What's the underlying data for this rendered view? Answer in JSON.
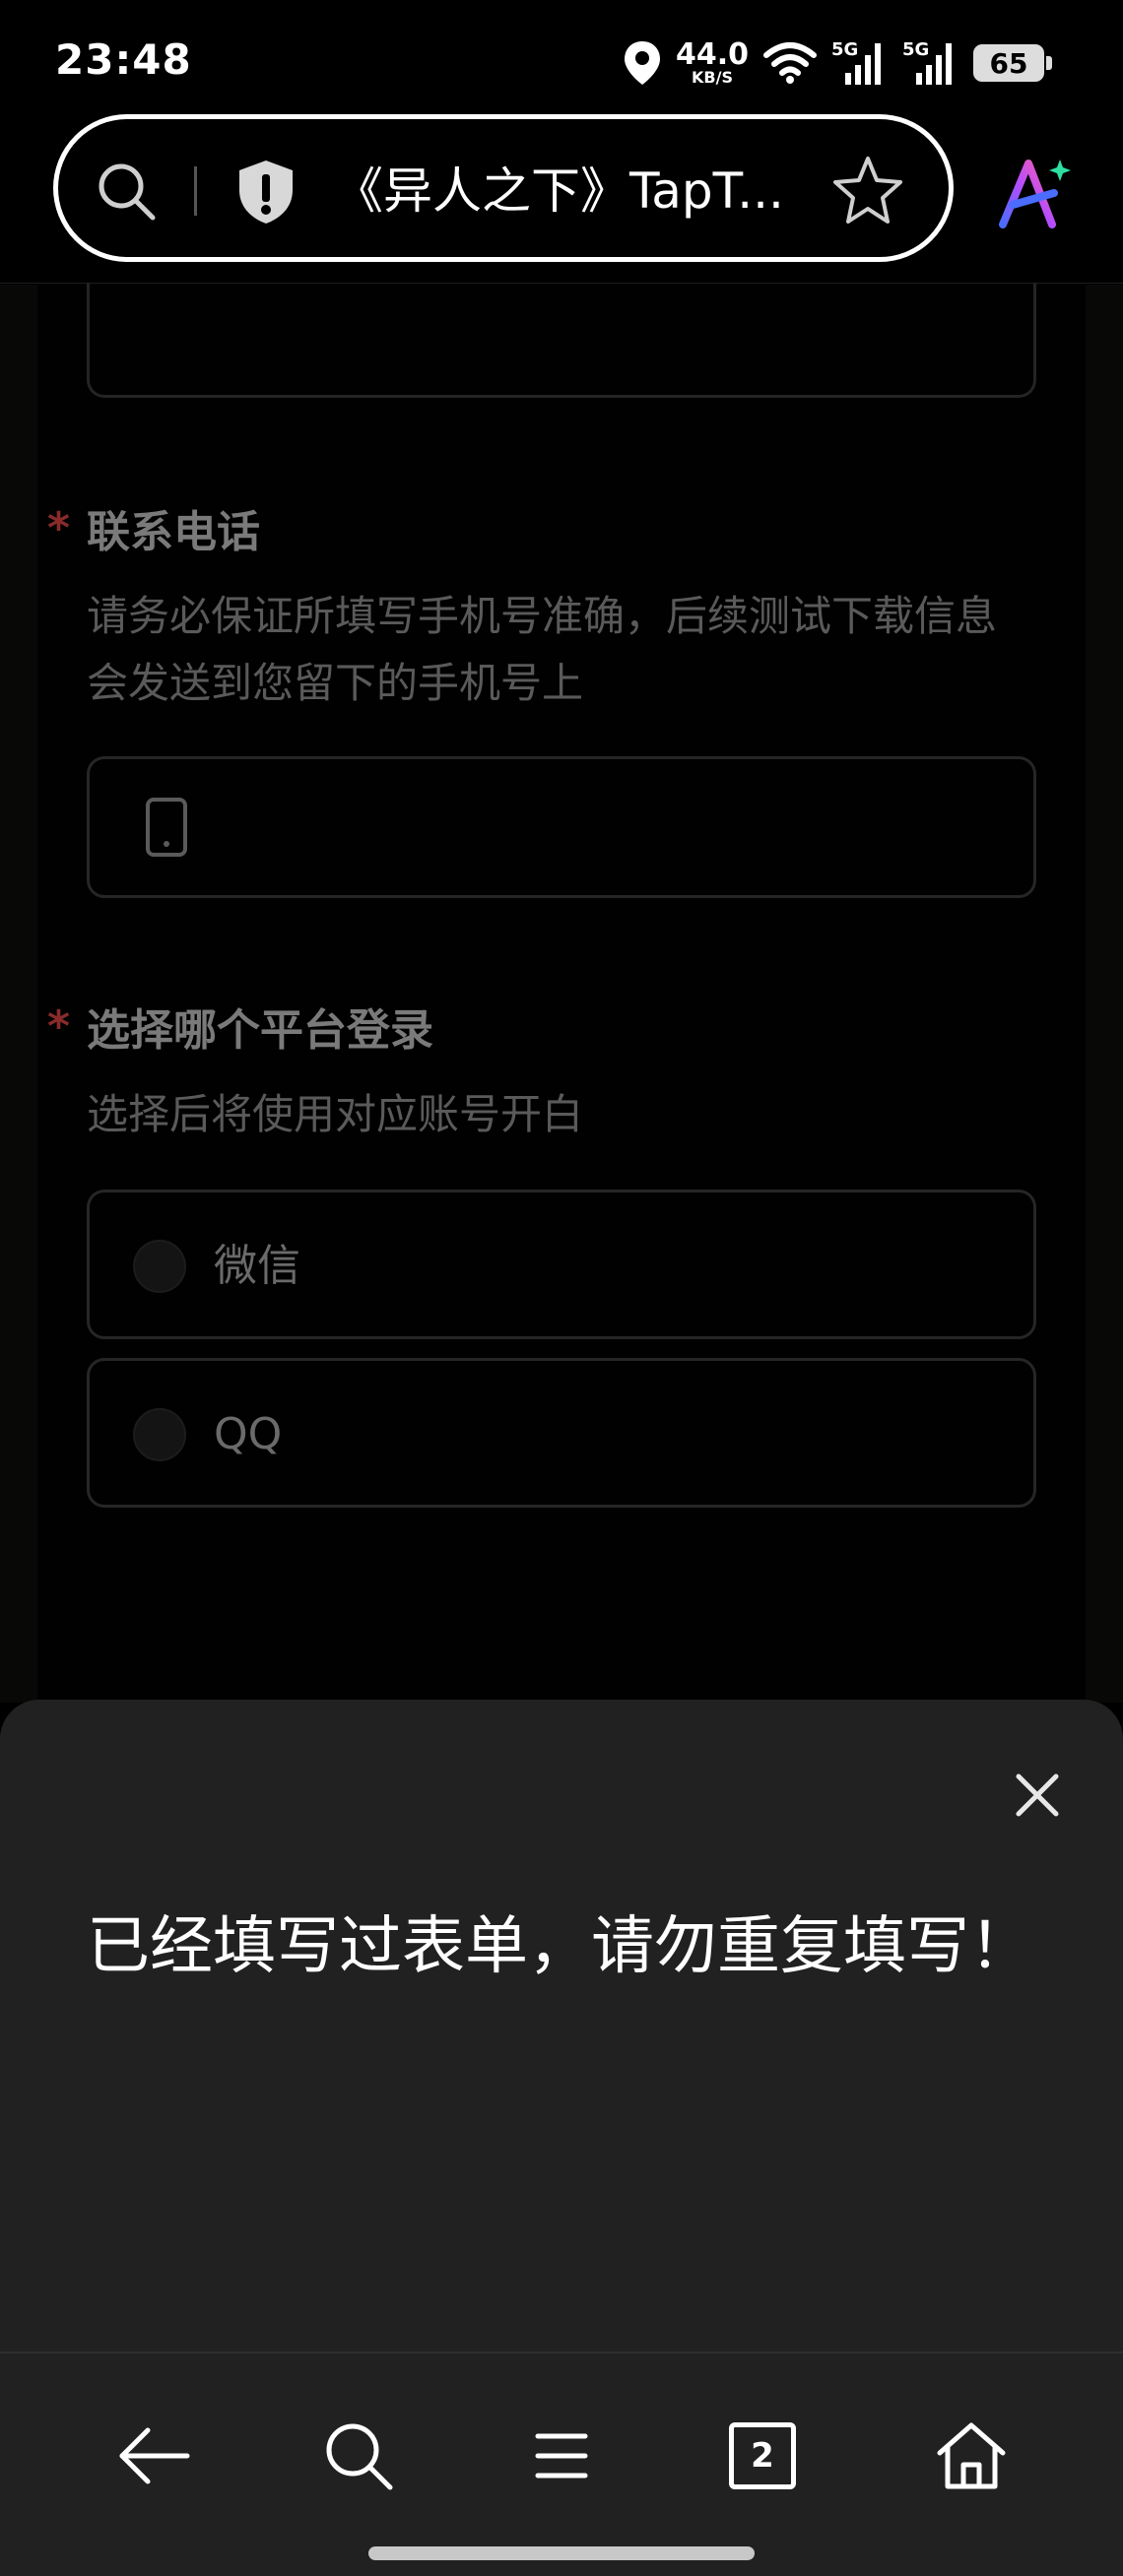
{
  "status_bar": {
    "time": "23:48",
    "net_speed_value": "44.0",
    "net_speed_unit": "KB/S",
    "signal_1_label": "5G",
    "signal_2_label": "5G",
    "battery": "65",
    "icons": [
      "location-icon",
      "wifi-icon",
      "signal-5g-icon",
      "signal-5g-icon",
      "battery-icon"
    ]
  },
  "browser": {
    "page_title": "《异人之下》TapT...",
    "icons": [
      "search-icon",
      "shield-warning-icon",
      "star-icon",
      "ai-assistant-icon"
    ]
  },
  "form": {
    "phone_field": {
      "title": "联系电话",
      "hint": "请务必保证所填写手机号准确，后续测试下载信息会发送到您留下的手机号上",
      "required_mark": "*",
      "icon": "phone-icon"
    },
    "platform_field": {
      "title": "选择哪个平台登录",
      "hint": "选择后将使用对应账号开白",
      "required_mark": "*",
      "options": [
        {
          "label": "微信",
          "selected": false
        },
        {
          "label": "QQ",
          "selected": false
        }
      ]
    }
  },
  "sheet": {
    "message": "已经填写过表单，请勿重复填写！",
    "icon": "close-icon"
  },
  "bottom_nav": {
    "tab_count": "2",
    "icons": [
      "back-arrow-icon",
      "search-icon",
      "menu-icon",
      "tabs-icon",
      "home-icon"
    ]
  },
  "colors": {
    "sheet_bg": "#212121",
    "required_star": "#8a2b2b",
    "page_bg": "#010101"
  }
}
